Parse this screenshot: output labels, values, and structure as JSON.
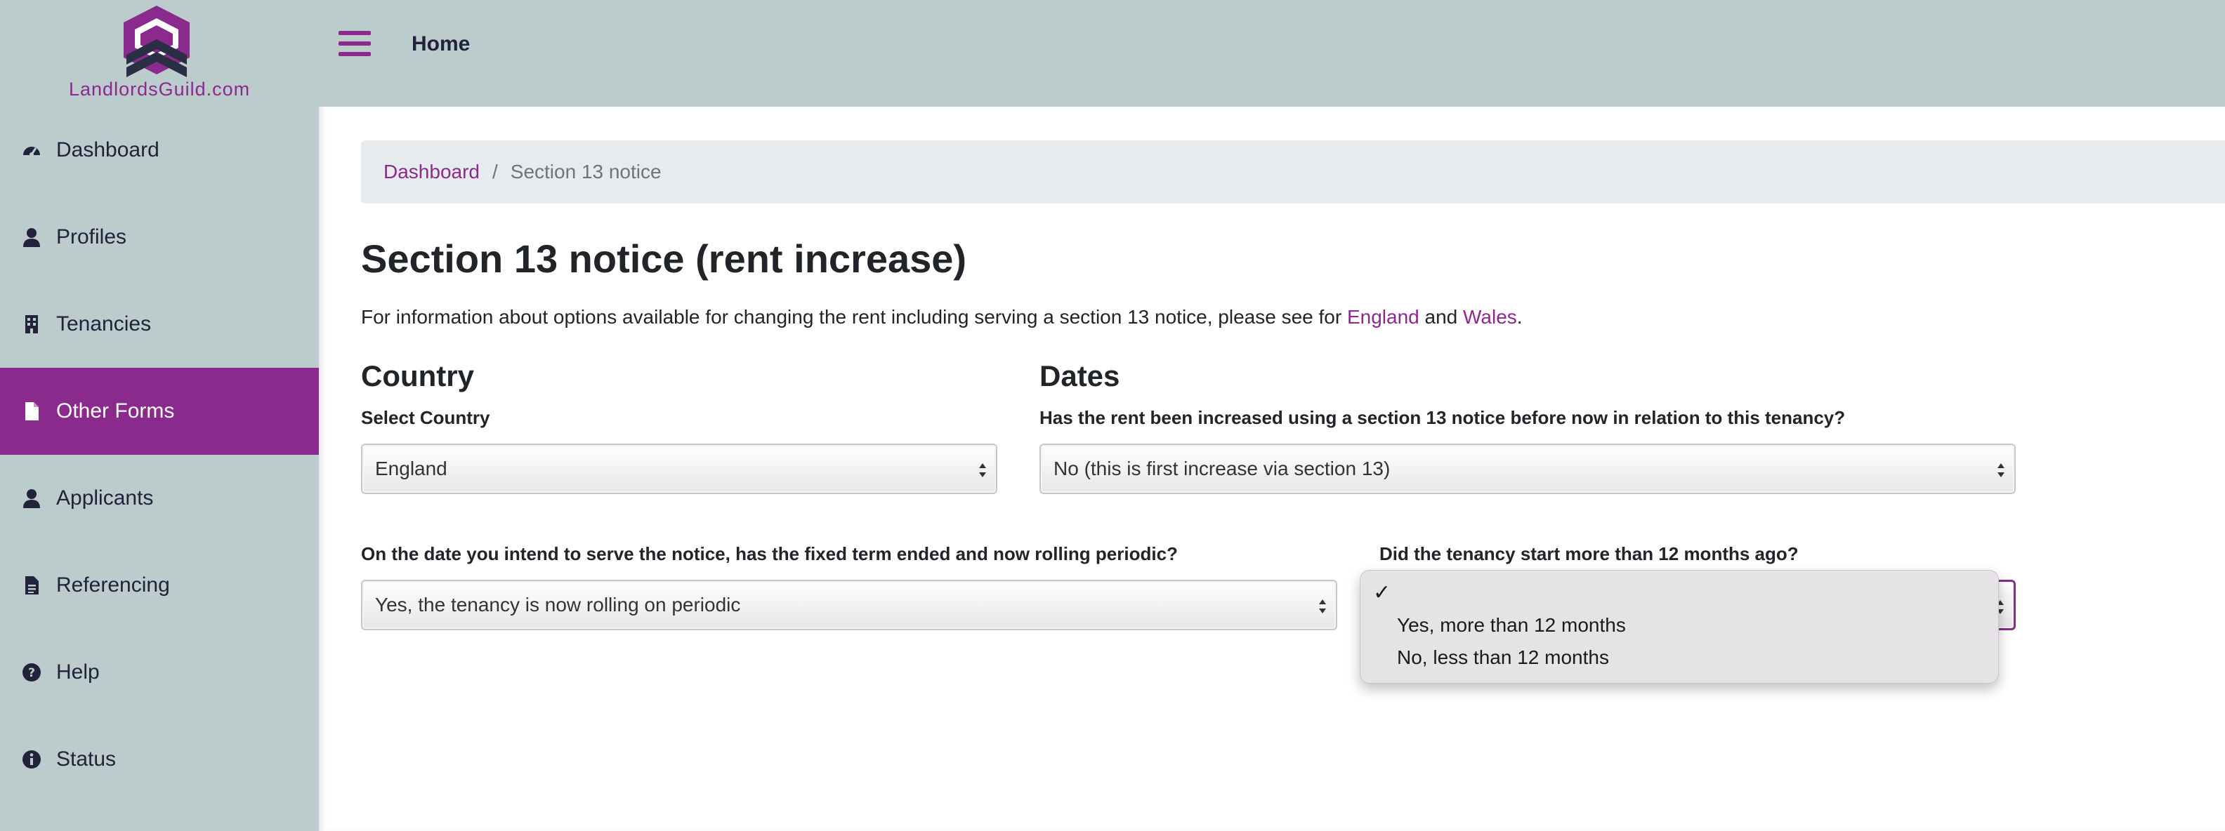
{
  "brand": {
    "logo_text": "LandlordsGuild.com",
    "accent": "#8b2a8d",
    "navy": "#2a2f45"
  },
  "topbar": {
    "menu_icon": "hamburger-icon",
    "home_label": "Home"
  },
  "sidebar": {
    "items": [
      {
        "label": "Dashboard",
        "icon": "speedometer-icon",
        "active": false
      },
      {
        "label": "Profiles",
        "icon": "person-icon",
        "active": false
      },
      {
        "label": "Tenancies",
        "icon": "building-icon",
        "active": false
      },
      {
        "label": "Other Forms",
        "icon": "document-icon",
        "active": true
      },
      {
        "label": "Applicants",
        "icon": "person-icon",
        "active": false
      },
      {
        "label": "Referencing",
        "icon": "file-text-icon",
        "active": false
      },
      {
        "label": "Help",
        "icon": "question-circle-icon",
        "active": false
      },
      {
        "label": "Status",
        "icon": "info-circle-icon",
        "active": false
      }
    ]
  },
  "breadcrumb": {
    "home": "Dashboard",
    "separator": "/",
    "current": "Section 13 notice"
  },
  "page": {
    "title": "Section 13 notice (rent increase)",
    "intro_before": "For information about options available for changing the rent including serving a section 13 notice, please see for ",
    "intro_link1": "England",
    "intro_and": " and ",
    "intro_link2": "Wales",
    "intro_end": "."
  },
  "country": {
    "heading": "Country",
    "label": "Select Country",
    "value": "England"
  },
  "dates": {
    "heading": "Dates",
    "prior_increase_label": "Has the rent been increased using a section 13 notice before now in relation to this tenancy?",
    "prior_increase_value": "No (this is first increase via section 13)",
    "fixed_term_label": "On the date you intend to serve the notice, has the fixed term ended and now rolling periodic?",
    "fixed_term_value": "Yes, the tenancy is now rolling on periodic",
    "start_label": "Did the tenancy start more than 12 months ago?",
    "start_value": "",
    "start_options": [
      "",
      "Yes, more than 12 months",
      "No, less than 12 months"
    ],
    "check_mark": "✓"
  }
}
